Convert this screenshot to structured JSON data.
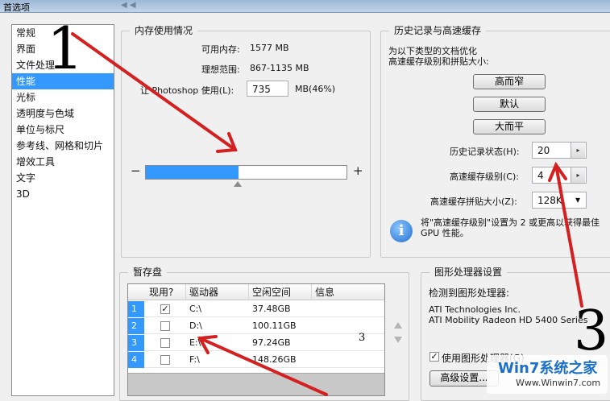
{
  "window": {
    "title": "首选项",
    "ghost_text": "◀  ◀"
  },
  "sidebar": {
    "items": [
      {
        "label": "常规"
      },
      {
        "label": "界面"
      },
      {
        "label": "文件处理"
      },
      {
        "label": "性能",
        "selected": true
      },
      {
        "label": "光标"
      },
      {
        "label": "透明度与色域"
      },
      {
        "label": "单位与标尺"
      },
      {
        "label": "参考线、网格和切片"
      },
      {
        "label": "增效工具"
      },
      {
        "label": "文字"
      },
      {
        "label": "3D"
      }
    ]
  },
  "memory": {
    "legend": "内存使用情况",
    "available_label": "可用内存:",
    "available_value": "1577 MB",
    "ideal_label": "理想范围:",
    "ideal_value": "867-1135 MB",
    "let_label": "让 Photoshop 使用(L):",
    "let_value": "735",
    "let_unit": "MB(46%)",
    "minus": "−",
    "plus": "+",
    "slider_percent": 46
  },
  "history": {
    "legend": "历史记录与高速缓存",
    "desc_line1": "为以下类型的文档优化",
    "desc_line2": "高速缓存级别和拼贴大小:",
    "btn_tall_thin": "高而窄",
    "btn_default": "默认",
    "btn_big_flat": "大而平",
    "states_label": "历史记录状态(H):",
    "states_value": "20",
    "cache_levels_label": "高速缓存级别(C):",
    "cache_levels_value": "4",
    "tile_size_label": "高速缓存拼贴大小(Z):",
    "tile_size_value": "128K",
    "spin_icon": "▸",
    "dropdown_icon": "▾",
    "info_line1": "将\"高速缓存级别\"设置为 2 或更高以获得最佳",
    "info_line2": "GPU 性能。",
    "info_glyph": "i"
  },
  "scratch": {
    "legend": "暂存盘",
    "columns": [
      "现用?",
      "驱动器",
      "空闲空间",
      "信息"
    ],
    "rows": [
      {
        "num": "1",
        "active": "✓",
        "drive": "C:\\",
        "free": "37.48GB"
      },
      {
        "num": "2",
        "active": "",
        "drive": "D:\\",
        "free": "100.11GB"
      },
      {
        "num": "3",
        "active": "",
        "drive": "E:\\",
        "free": "97.24GB"
      },
      {
        "num": "4",
        "active": "",
        "drive": "F:\\",
        "free": "148.26GB"
      }
    ]
  },
  "gpu": {
    "legend": "图形处理器设置",
    "detected_label": "检测到图形处理器:",
    "vendor": "ATI Technologies Inc.",
    "model": "ATI Mobility Radeon HD 5400 Series",
    "use_gpu_label": "使用图形处理器(G)",
    "use_gpu_check": "✓",
    "advanced_button": "高级设置..."
  },
  "annotations": {
    "num1": "1",
    "num3_big": "3",
    "num3_small": "3",
    "arrow_color": "#d42020"
  },
  "watermark": {
    "logo_text": "Win7系统之家",
    "site_text": "Www.Winwin7.com"
  }
}
